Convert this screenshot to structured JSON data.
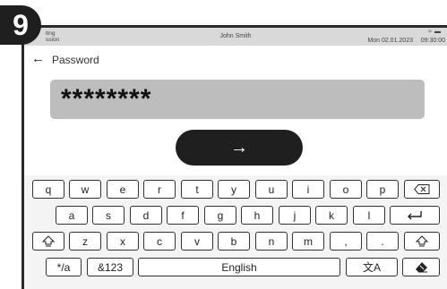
{
  "step": "9",
  "statusbar": {
    "app_line1": "ting",
    "app_line2": "ssion",
    "user": "John Smith",
    "date": "Mon 02.01.2023",
    "time": "09:30:00",
    "icons": [
      "wifi-icon",
      "battery-icon"
    ]
  },
  "header": {
    "title": "Password"
  },
  "password_field": {
    "value": "********"
  },
  "submit_label": "→",
  "keyboard": {
    "row1": [
      "q",
      "w",
      "e",
      "r",
      "t",
      "y",
      "u",
      "i",
      "o",
      "p"
    ],
    "row2": [
      "a",
      "s",
      "d",
      "f",
      "g",
      "h",
      "j",
      "k",
      "l"
    ],
    "row3": [
      "z",
      "x",
      "c",
      "v",
      "b",
      "n",
      "m",
      ",",
      "."
    ],
    "symbols_key": "*/a",
    "numbers_key": "&123",
    "space_label": "English",
    "backspace_icon": "backspace-icon",
    "enter_icon": "enter-icon",
    "shift_icon": "shift-icon",
    "language_icon": "translate-icon",
    "eraser_icon": "eraser-icon"
  }
}
